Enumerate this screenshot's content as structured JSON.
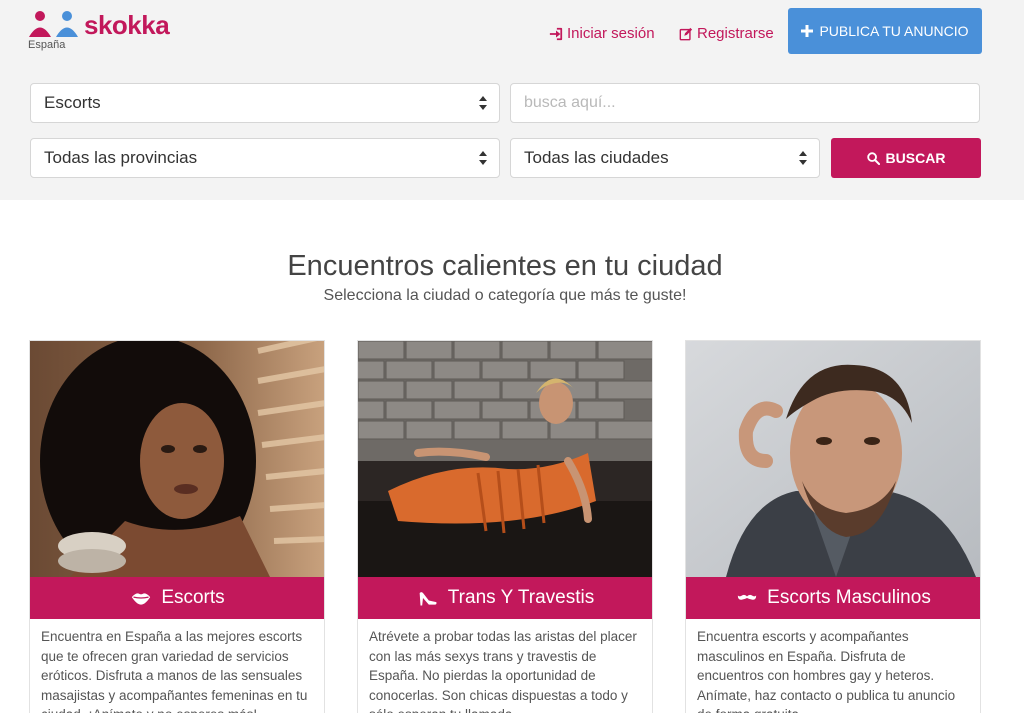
{
  "brand": {
    "name": "skokka",
    "country": "España"
  },
  "nav": {
    "login": "Iniciar sesión",
    "register": "Registrarse",
    "publish": "PUBLICA TU ANUNCIO"
  },
  "search": {
    "category_selected": "Escorts",
    "query_placeholder": "busca aquí...",
    "province_selected": "Todas las provincias",
    "city_selected": "Todas las ciudades",
    "button_label": "BUSCAR"
  },
  "hero": {
    "title": "Encuentros calientes en tu ciudad",
    "subtitle": "Selecciona la ciudad o categoría que más te guste!"
  },
  "categories": [
    {
      "title": "Escorts",
      "icon": "lips-icon",
      "text": "Encuentra en España a las mejores escorts que te ofrecen gran variedad de servicios eróticos. Disfruta a manos de las sensuales masajistas y acompañantes femeninas en tu ciudad. ¡Anímate y no esperes más!"
    },
    {
      "title": "Trans Y Travestis",
      "icon": "high-heel-icon",
      "text": "Atrévete a probar todas las aristas del placer con las más sexys trans y travestis de España. No pierdas la oportunidad de conocerlas. Son chicas dispuestas a todo y sólo esperan tu llamada."
    },
    {
      "title": "Escorts Masculinos",
      "icon": "mustache-icon",
      "text": "Encuentra escorts y acompañantes masculinos en España. Disfruta de encuentros con hombres gay y heteros. Anímate, haz contacto o publica tu anuncio de forma gratuita."
    }
  ],
  "colors": {
    "brand": "#c2185b",
    "publish": "#4a90d9",
    "header_bg": "#f3f3f3",
    "logo_blue": "#4a90d9"
  }
}
